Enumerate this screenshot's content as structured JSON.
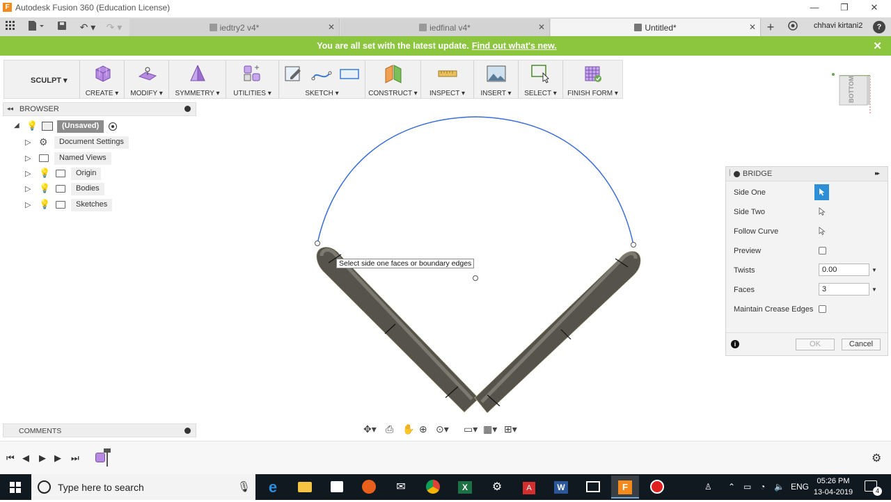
{
  "window": {
    "app_icon_letter": "F",
    "title": "Autodesk Fusion 360 (Education License)",
    "controls": {
      "minimize": "—",
      "restore": "❐",
      "close": "✕"
    }
  },
  "tabs": [
    {
      "label": "iedtry2 v4*",
      "active": false
    },
    {
      "label": "iedfinal v4*",
      "active": false
    },
    {
      "label": "Untitled*",
      "active": true
    }
  ],
  "tab_close": "✕",
  "new_tab": "+",
  "user": {
    "name": "chhavi kirtani2",
    "help": "?"
  },
  "banner": {
    "text": "You are all set with the latest update.",
    "link": "Find out what's new.",
    "close": "✕",
    "color": "#8cc63f"
  },
  "toolbar": {
    "workspace": "SCULPT ▾",
    "groups": [
      {
        "label": "CREATE ▾",
        "icon": "create-box-icon"
      },
      {
        "label": "MODIFY ▾",
        "icon": "modify-icon"
      },
      {
        "label": "SYMMETRY ▾",
        "icon": "symmetry-icon"
      },
      {
        "label": "UTILITIES ▾",
        "icon": "utilities-icon"
      },
      {
        "label": "SKETCH ▾",
        "icon": "sketch-icons"
      },
      {
        "label": "CONSTRUCT ▾",
        "icon": "construct-plane-icon"
      },
      {
        "label": "INSPECT ▾",
        "icon": "measure-icon"
      },
      {
        "label": "INSERT ▾",
        "icon": "insert-image-icon"
      },
      {
        "label": "SELECT ▾",
        "icon": "select-icon"
      },
      {
        "label": "FINISH FORM ▾",
        "icon": "finish-form-icon"
      }
    ]
  },
  "browser": {
    "title": "BROWSER",
    "root": "(Unsaved)",
    "items": [
      {
        "label": "Document Settings",
        "icon": "gear-icon"
      },
      {
        "label": "Named Views",
        "icon": "folder-icon"
      },
      {
        "label": "Origin",
        "icon": "folder-icon"
      },
      {
        "label": "Bodies",
        "icon": "folder-icon"
      },
      {
        "label": "Sketches",
        "icon": "folder-icon"
      }
    ]
  },
  "viewport": {
    "tooltip": "Select side one faces or boundary edges",
    "curve_color": "#3a6fd8"
  },
  "viewcube": {
    "face_label": "BOTTOM"
  },
  "bridge": {
    "title": "BRIDGE",
    "expand": "▸▸",
    "rows": {
      "side_one": "Side One",
      "side_two": "Side Two",
      "follow_curve": "Follow Curve",
      "preview": "Preview",
      "twists": "Twists",
      "faces": "Faces",
      "maintain_crease": "Maintain Crease Edges"
    },
    "values": {
      "twists": "0.00",
      "faces": "3"
    },
    "ok": "OK",
    "cancel": "Cancel"
  },
  "comments": {
    "title": "COMMENTS"
  },
  "taskbar": {
    "search_placeholder": "Type here to search",
    "language": "ENG",
    "time": "05:26 PM",
    "date": "13-04-2019",
    "notifications": "4"
  }
}
